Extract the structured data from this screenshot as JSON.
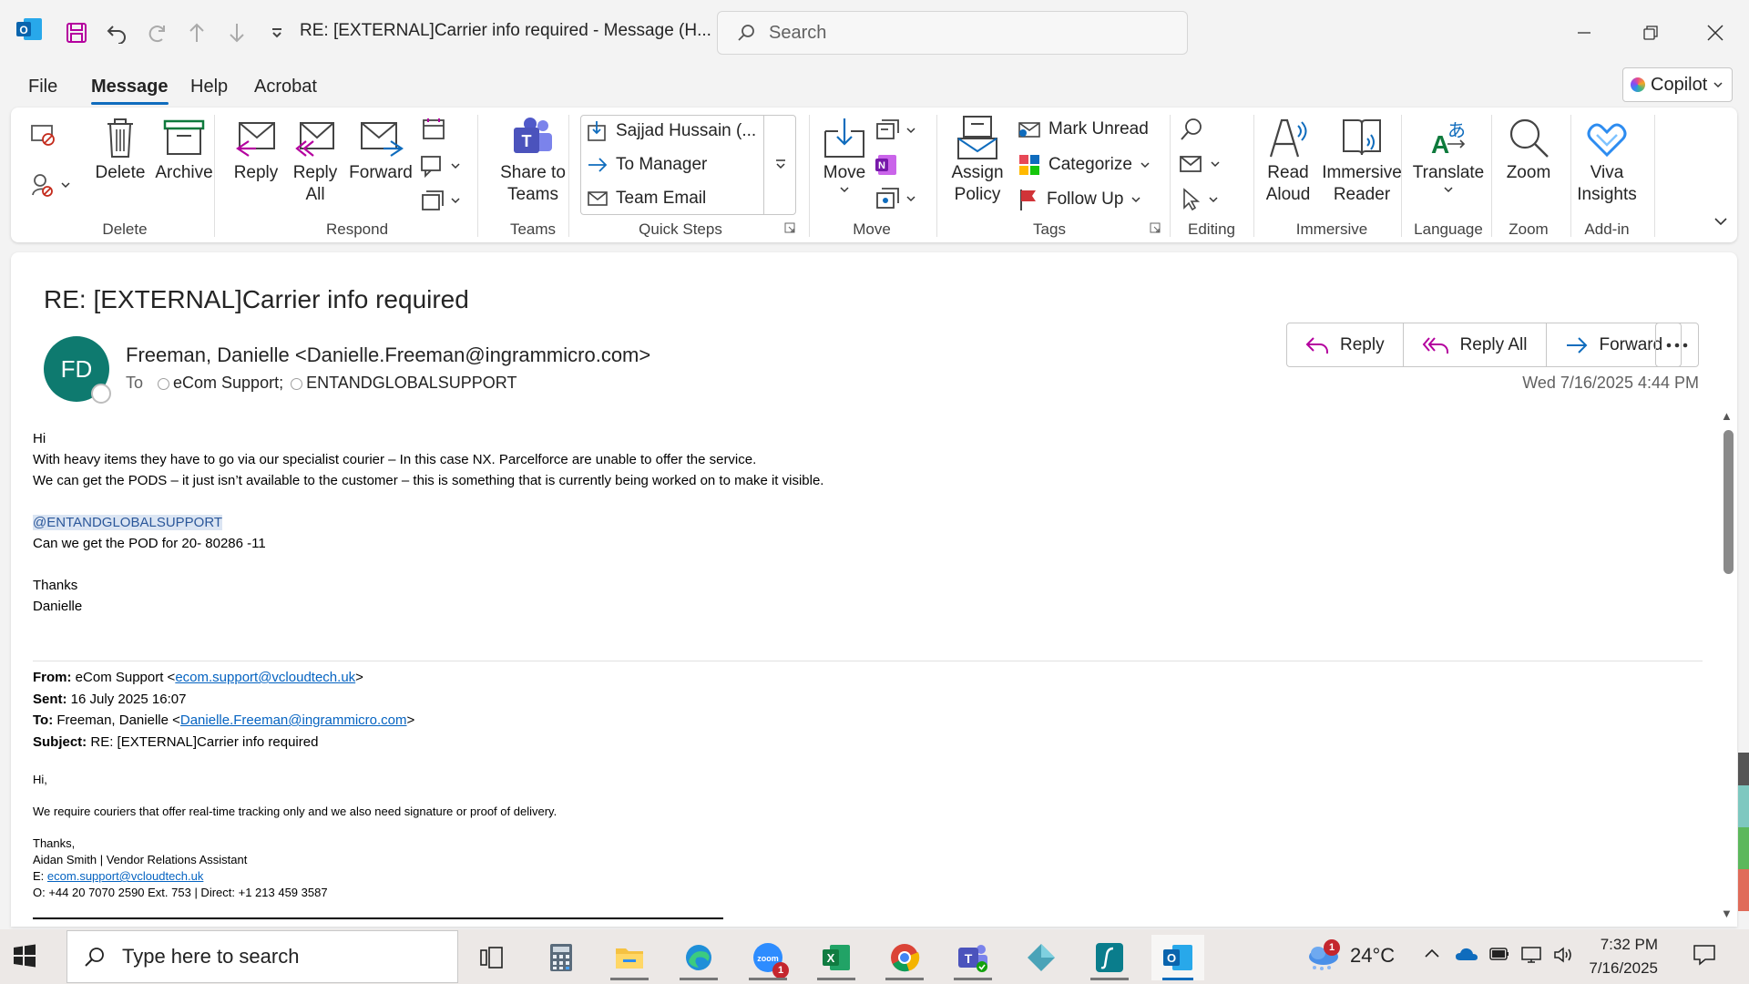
{
  "window": {
    "title": "RE: [EXTERNAL]Carrier info required  -  Message (H...",
    "search_placeholder": "Search"
  },
  "menu": {
    "tabs": [
      "File",
      "Message",
      "Help",
      "Acrobat"
    ],
    "active": "Message",
    "copilot": "Copilot"
  },
  "ribbon": {
    "delete_group": {
      "label": "Delete",
      "delete": "Delete",
      "archive": "Archive"
    },
    "respond_group": {
      "label": "Respond",
      "reply": "Reply",
      "reply_all_1": "Reply",
      "reply_all_2": "All",
      "forward": "Forward"
    },
    "teams_group": {
      "label": "Teams",
      "share_1": "Share to",
      "share_2": "Teams"
    },
    "quicksteps_group": {
      "label": "Quick Steps",
      "items": [
        "Sajjad Hussain (...",
        "To Manager",
        "Team Email"
      ]
    },
    "move_group": {
      "label": "Move",
      "move": "Move"
    },
    "tags_group": {
      "label": "Tags",
      "assign_1": "Assign",
      "assign_2": "Policy",
      "mark_unread": "Mark Unread",
      "categorize": "Categorize",
      "follow_up": "Follow Up"
    },
    "editing_group": {
      "label": "Editing"
    },
    "immersive_group": {
      "label": "Immersive",
      "read_1": "Read",
      "read_2": "Aloud",
      "reader_1": "Immersive",
      "reader_2": "Reader"
    },
    "language_group": {
      "label": "Language",
      "translate": "Translate"
    },
    "zoom_group": {
      "label": "Zoom",
      "zoom": "Zoom"
    },
    "addin_group": {
      "label": "Add-in",
      "viva_1": "Viva",
      "viva_2": "Insights"
    }
  },
  "message": {
    "subject": "RE: [EXTERNAL]Carrier info required",
    "avatar_initials": "FD",
    "sender": "Freeman, Danielle <Danielle.Freeman@ingrammicro.com>",
    "to_label": "To",
    "recipients": [
      "eCom Support;",
      "ENTANDGLOBALSUPPORT"
    ],
    "actions": {
      "reply": "Reply",
      "reply_all": "Reply All",
      "forward": "Forward"
    },
    "date": "Wed 7/16/2025 4:44 PM",
    "body": {
      "greeting": "Hi",
      "line1": "With heavy items they have to go via our specialist courier – In this case NX. Parcelforce are unable to offer the service.",
      "line2": "We can get the PODS – it just isn’t available to the customer – this is something that is currently being worked on to make it visible.",
      "mention": "@ENTANDGLOBALSUPPORT",
      "line3": "Can we get the POD for 20- 80286 -11",
      "thanks": "Thanks",
      "signoff": "Danielle"
    },
    "quoted": {
      "from_label": "From:",
      "from_name": "eCom Support <",
      "from_email": "ecom.support@vcloudtech.uk",
      "sent_label": "Sent:",
      "sent_value": "16 July 2025 16:07",
      "to_label": "To:",
      "to_name": "Freeman, Danielle <",
      "to_email": "Danielle.Freeman@ingrammicro.com",
      "subject_label": "Subject:",
      "subject_value": "RE: [EXTERNAL]Carrier info required",
      "hi": "Hi,",
      "body": "We require couriers that offer real-time tracking only and we also need signature or proof of delivery.",
      "thanks": "Thanks,",
      "sig_name": "Aidan Smith | Vendor Relations Assistant",
      "sig_e_label": "E:",
      "sig_email": "ecom.support@vcloudtech.uk",
      "sig_phone": "O:  +44 20 7070 2590 Ext. 753 | Direct: +1 213 459 3587"
    }
  },
  "taskbar": {
    "search_placeholder": "Type here to search",
    "weather": "24°C",
    "time": "7:32 PM",
    "date": "7/16/2025",
    "badges": {
      "zoom": "1",
      "weather": "1"
    }
  },
  "colors": {
    "accent": "#0f6cbd",
    "avatar": "#0e7a6f",
    "link": "#0563c1"
  }
}
